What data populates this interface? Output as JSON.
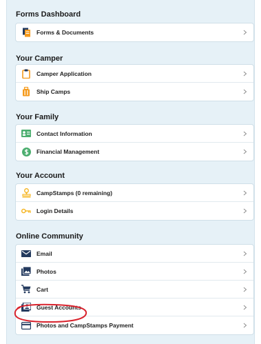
{
  "colors": {
    "panel_bg": "#e6f1f7",
    "item_bg": "#ffffff",
    "orange_icon": "#f59a1b",
    "navy_icon": "#233a5e",
    "green_icon": "#4cae6f",
    "annotation_red": "#d9232d"
  },
  "sections": [
    {
      "title": "Forms Dashboard",
      "items": [
        {
          "label": "Forms & Documents",
          "icon": "documents-icon"
        }
      ]
    },
    {
      "title": "Your Camper",
      "items": [
        {
          "label": "Camper Application",
          "icon": "clipboard-icon"
        },
        {
          "label": "Ship Camps",
          "icon": "bag-icon"
        }
      ]
    },
    {
      "title": "Your Family",
      "items": [
        {
          "label": "Contact Information",
          "icon": "contact-card-icon"
        },
        {
          "label": "Financial Management",
          "icon": "dollar-circle-icon"
        }
      ]
    },
    {
      "title": "Your Account",
      "items": [
        {
          "label": "CampStamps (0 remaining)",
          "icon": "stamp-icon"
        },
        {
          "label": "Login Details",
          "icon": "key-icon"
        }
      ]
    },
    {
      "title": "Online Community",
      "items": [
        {
          "label": "Email",
          "icon": "envelope-icon"
        },
        {
          "label": "Photos",
          "icon": "photos-icon"
        },
        {
          "label": "Cart",
          "icon": "cart-icon"
        },
        {
          "label": "Guest Accounts",
          "icon": "guest-accounts-icon"
        },
        {
          "label": "Photos and CampStamps Payment",
          "icon": "credit-card-icon"
        }
      ]
    }
  ]
}
